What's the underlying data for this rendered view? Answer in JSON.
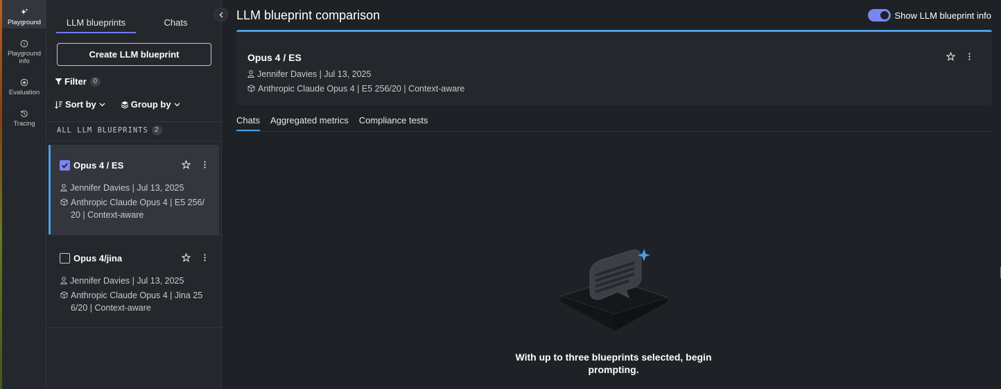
{
  "rail": {
    "items": [
      {
        "label": "Playground",
        "icon": "sparkle-icon",
        "active": true
      },
      {
        "label": "Playground info",
        "icon": "info-icon",
        "active": false
      },
      {
        "label": "Evaluation",
        "icon": "evaluation-icon",
        "active": false
      },
      {
        "label": "Tracing",
        "icon": "history-icon",
        "active": false
      }
    ]
  },
  "panel": {
    "tabs": [
      {
        "label": "LLM blueprints",
        "active": true
      },
      {
        "label": "Chats",
        "active": false
      }
    ],
    "create_button": "Create LLM blueprint",
    "filter_label": "Filter",
    "filter_count": "0",
    "sort_label": "Sort by",
    "group_label": "Group by",
    "section_label": "ALL LLM BLUEPRINTS",
    "section_count": "2",
    "blueprints": [
      {
        "title": "Opus 4 / ES",
        "checked": true,
        "author_date": "Jennifer Davies | Jul 13, 2025",
        "model_line1": "Anthropic Claude Opus 4 | E5 256/",
        "model_line2": "20 | Context-aware"
      },
      {
        "title": "Opus 4/jina",
        "checked": false,
        "author_date": "Jennifer Davies | Jul 13, 2025",
        "model_line1": "Anthropic Claude Opus 4 | Jina 25",
        "model_line2": "6/20 | Context-aware"
      }
    ]
  },
  "main": {
    "title": "LLM blueprint comparison",
    "toggle_label": "Show LLM blueprint info",
    "toggle_on": true,
    "blueprint_card": {
      "title": "Opus 4 / ES",
      "author_date": "Jennifer Davies | Jul 13, 2025",
      "model": "Anthropic Claude Opus 4 | E5 256/20 | Context-aware"
    },
    "tabs": [
      {
        "label": "Chats",
        "active": true
      },
      {
        "label": "Aggregated metrics",
        "active": false
      },
      {
        "label": "Compliance tests",
        "active": false
      }
    ],
    "empty_state_line1": "With up to three blueprints selected, begin",
    "empty_state_line2": "prompting."
  },
  "colors": {
    "accent": "#7b86f0",
    "selected_border": "#4aa0e6",
    "background": "#1e2125",
    "panel": "#24272c"
  }
}
